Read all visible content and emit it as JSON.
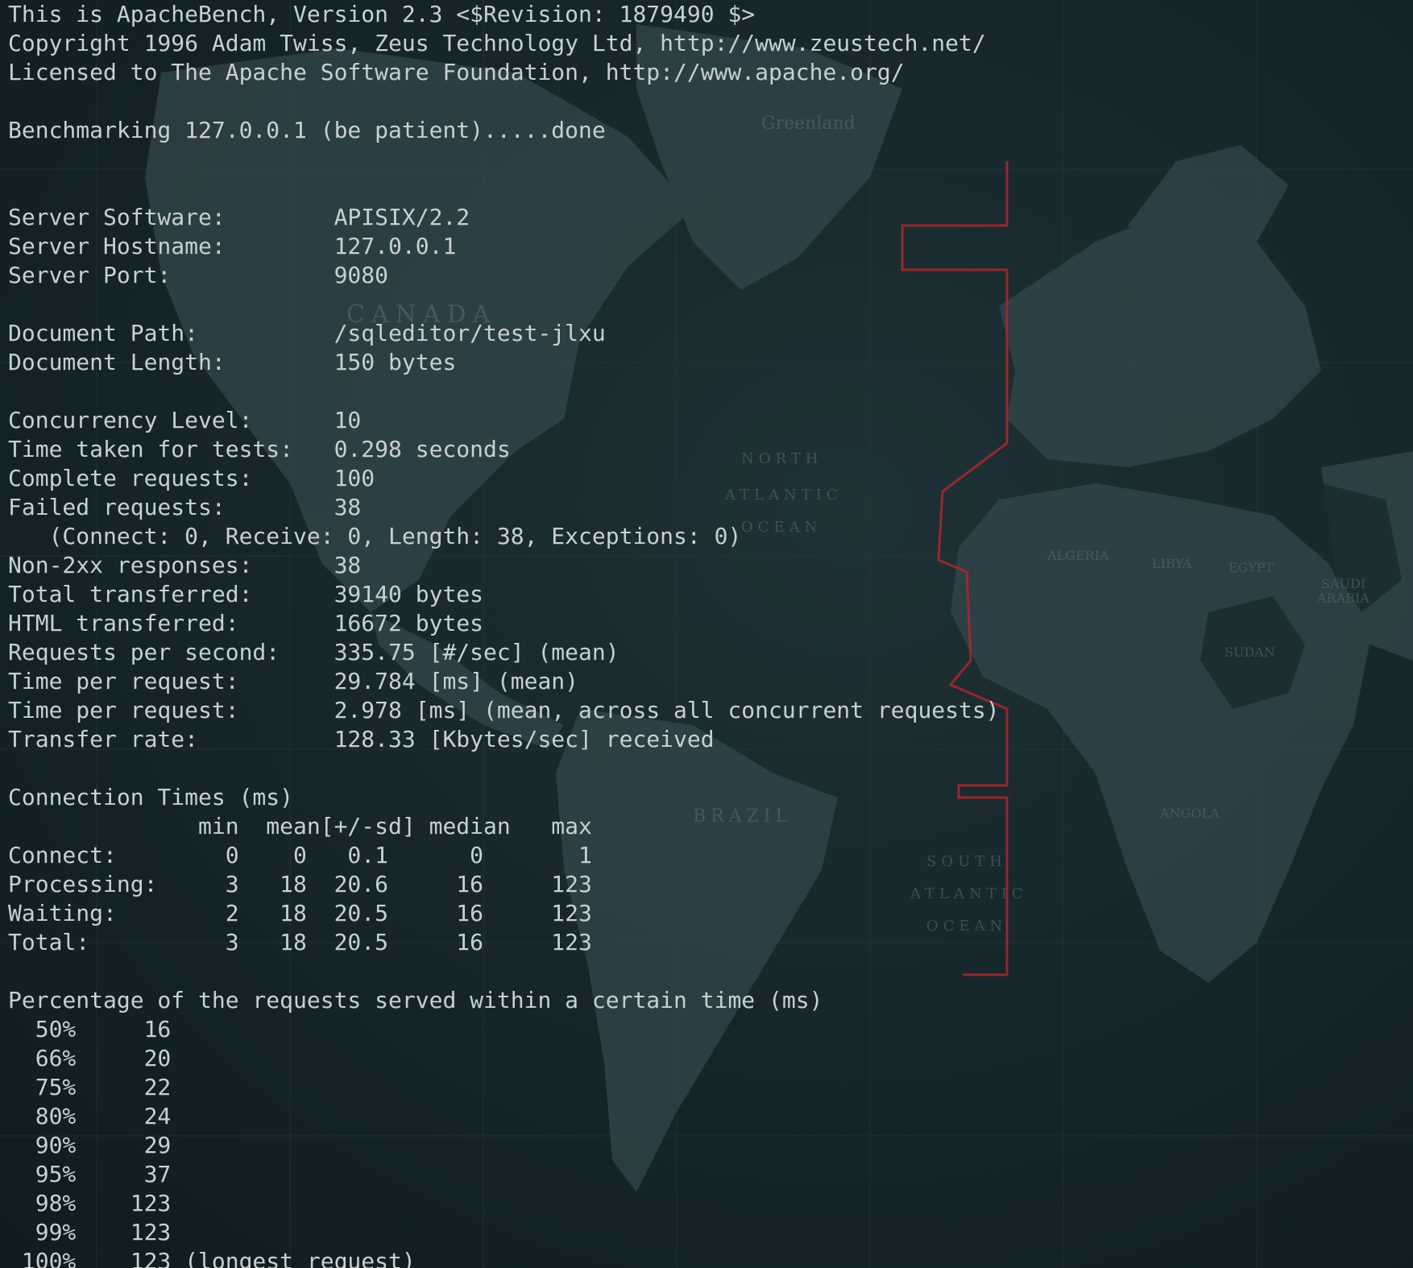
{
  "terminal": {
    "lines": [
      "This is ApacheBench, Version 2.3 <$Revision: 1879490 $>",
      "Copyright 1996 Adam Twiss, Zeus Technology Ltd, http://www.zeustech.net/",
      "Licensed to The Apache Software Foundation, http://www.apache.org/",
      "",
      "Benchmarking 127.0.0.1 (be patient).....done",
      "",
      "",
      "Server Software:        APISIX/2.2",
      "Server Hostname:        127.0.0.1",
      "Server Port:            9080",
      "",
      "Document Path:          /sqleditor/test-jlxu",
      "Document Length:        150 bytes",
      "",
      "Concurrency Level:      10",
      "Time taken for tests:   0.298 seconds",
      "Complete requests:      100",
      "Failed requests:        38",
      "   (Connect: 0, Receive: 0, Length: 38, Exceptions: 0)",
      "Non-2xx responses:      38",
      "Total transferred:      39140 bytes",
      "HTML transferred:       16672 bytes",
      "Requests per second:    335.75 [#/sec] (mean)",
      "Time per request:       29.784 [ms] (mean)",
      "Time per request:       2.978 [ms] (mean, across all concurrent requests)",
      "Transfer rate:          128.33 [Kbytes/sec] received",
      "",
      "Connection Times (ms)",
      "              min  mean[+/-sd] median   max",
      "Connect:        0    0   0.1      0       1",
      "Processing:     3   18  20.6     16     123",
      "Waiting:        2   18  20.5     16     123",
      "Total:          3   18  20.5     16     123",
      "",
      "Percentage of the requests served within a certain time (ms)",
      "  50%     16",
      "  66%     20",
      "  75%     22",
      "  80%     24",
      "  90%     29",
      "  95%     37",
      "  98%    123",
      "  99%    123",
      " 100%    123 (longest request)"
    ]
  }
}
